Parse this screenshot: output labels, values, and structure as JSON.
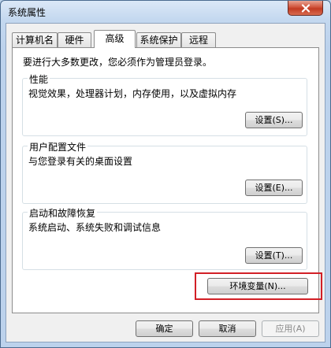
{
  "window": {
    "title": "系统属性"
  },
  "tabs": [
    {
      "label": "计算机名"
    },
    {
      "label": "硬件"
    },
    {
      "label": "高级"
    },
    {
      "label": "系统保护"
    },
    {
      "label": "远程"
    }
  ],
  "active_tab": "高级",
  "admin_note": "要进行大多数更改，您必须作为管理员登录。",
  "groups": {
    "performance": {
      "title": "性能",
      "description": "视觉效果，处理器计划，内存使用，以及虚拟内存",
      "button": "设置(S)..."
    },
    "profiles": {
      "title": "用户配置文件",
      "description": "与您登录有关的桌面设置",
      "button": "设置(E)..."
    },
    "startup": {
      "title": "启动和故障恢复",
      "description": "系统启动、系统失败和调试信息",
      "button": "设置(T)..."
    }
  },
  "env_button": "环境变量(N)...",
  "footer": {
    "ok": "确定",
    "cancel": "取消",
    "apply": "应用(A)"
  },
  "colors": {
    "highlight": "#d21f26",
    "close_button": "#c23b22"
  },
  "icons": {
    "close": "close-icon"
  }
}
